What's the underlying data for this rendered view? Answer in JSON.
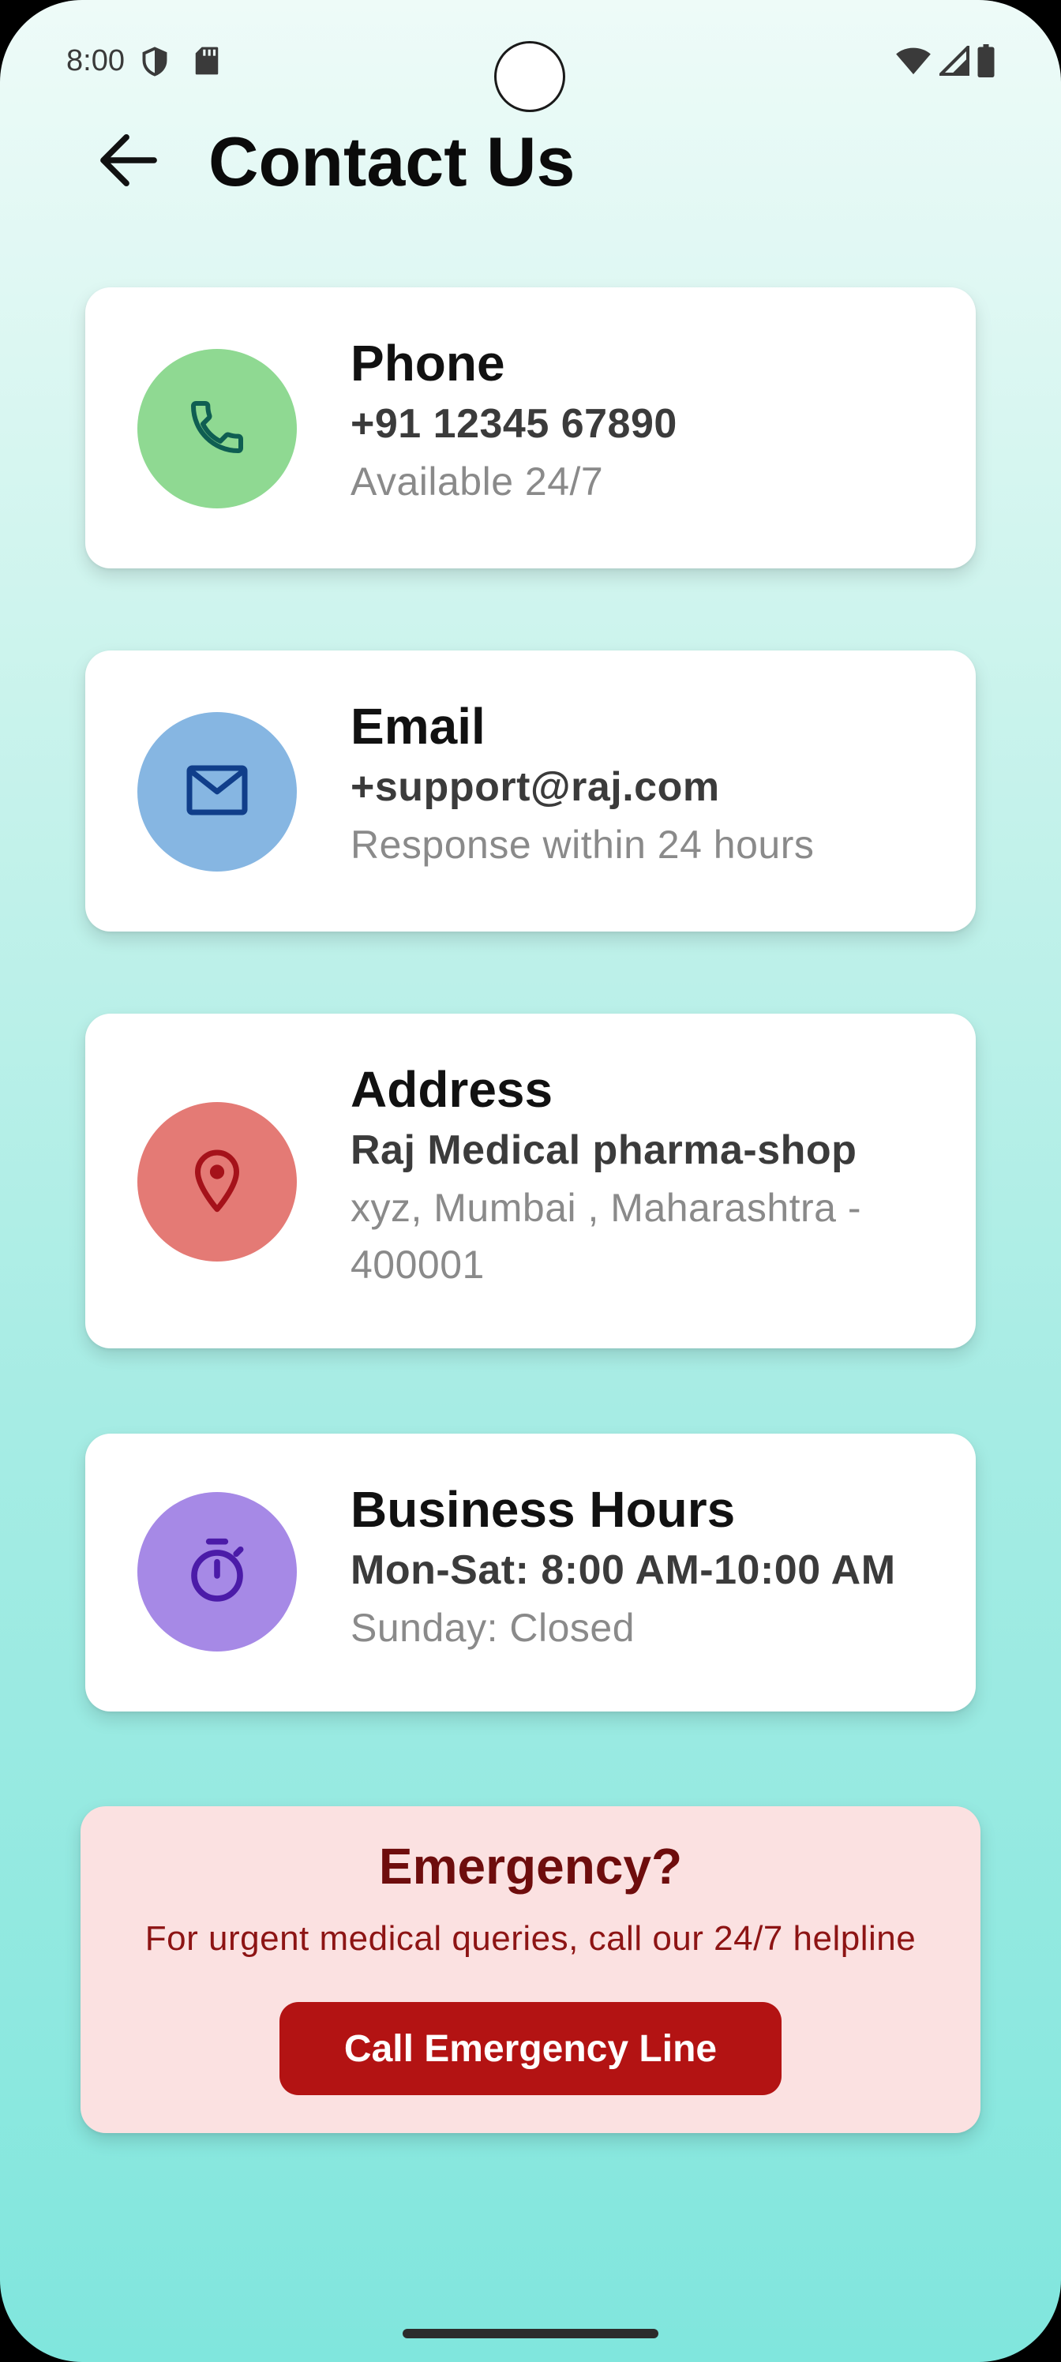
{
  "status_bar": {
    "time": "8:00",
    "icons": [
      "shield-icon",
      "sd-card-icon",
      "wifi-icon",
      "signal-icon",
      "battery-icon"
    ]
  },
  "header": {
    "back_icon": "arrow-left-icon",
    "title": "Contact Us"
  },
  "cards": [
    {
      "title": "Phone",
      "primary": "+91 12345 67890",
      "secondary": "Available 24/7",
      "icon": "phone-icon",
      "circle_color": "#8fd992",
      "icon_color": "#0f5e52"
    },
    {
      "title": "Email",
      "primary": "+support@raj.com",
      "secondary": "Response within 24 hours",
      "icon": "mail-icon",
      "circle_color": "#86b6e2",
      "icon_color": "#103e8a"
    },
    {
      "title": "Address",
      "primary": "Raj Medical pharma-shop",
      "secondary": "xyz, Mumbai , Maharashtra - 400001",
      "icon": "location-pin-icon",
      "circle_color": "#e47a75",
      "icon_color": "#a5121a"
    },
    {
      "title": "Business Hours",
      "primary": "Mon-Sat: 8:00 AM-10:00 AM",
      "secondary": "Sunday: Closed",
      "icon": "timer-icon",
      "circle_color": "#a689e6",
      "icon_color": "#4b1ba8"
    }
  ],
  "emergency": {
    "title": "Emergency?",
    "subtitle": "For urgent medical queries, call our 24/7 helpline",
    "button_label": "Call Emergency Line",
    "background": "#fbe1e1",
    "button_color": "#b31313"
  }
}
